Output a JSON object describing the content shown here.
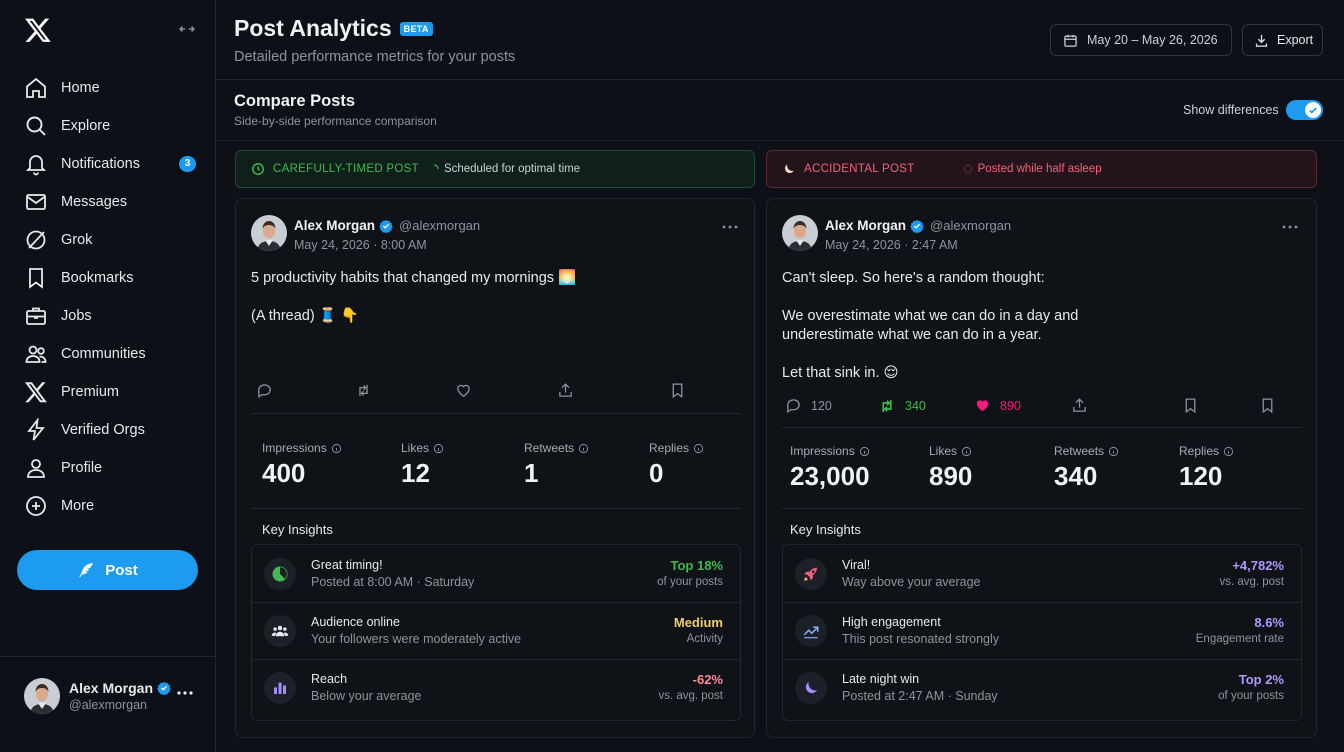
{
  "sidebar": {
    "items": [
      {
        "label": "Home",
        "icon": "home-icon"
      },
      {
        "label": "Explore",
        "icon": "search-icon"
      },
      {
        "label": "Notifications",
        "icon": "bell-icon",
        "badge": "3"
      },
      {
        "label": "Messages",
        "icon": "mail-icon"
      },
      {
        "label": "Grok",
        "icon": "grok-icon"
      },
      {
        "label": "Bookmarks",
        "icon": "bookmark-icon"
      },
      {
        "label": "Jobs",
        "icon": "briefcase-icon"
      },
      {
        "label": "Communities",
        "icon": "people-icon"
      },
      {
        "label": "Premium",
        "icon": "x-logo-icon"
      },
      {
        "label": "Verified Orgs",
        "icon": "lightning-icon"
      },
      {
        "label": "Profile",
        "icon": "user-icon"
      },
      {
        "label": "More",
        "icon": "more-circle-icon"
      }
    ],
    "post_button": "Post",
    "account": {
      "name": "Alex Morgan",
      "handle": "@alexmorgan"
    }
  },
  "header": {
    "title": "Post Analytics",
    "badge": "BETA",
    "subtitle": "Detailed performance metrics for your posts",
    "date_range": "May 20 – May 26, 2026",
    "export_label": "Export"
  },
  "compare": {
    "title": "Compare Posts",
    "subtitle": "Side-by-side performance comparison",
    "toggle_label": "Show differences",
    "toggle_on": true
  },
  "posts": [
    {
      "banner_tag": "CAREFULLY-TIMED POST",
      "banner_text": "Scheduled for optimal time",
      "accent": "#3fb950",
      "author": "Alex Morgan",
      "handle": "@alexmorgan",
      "date": "May 24, 2026 · 8:00 AM",
      "text": [
        "5 productivity habits that changed my mornings 🌅",
        "(A thread) 🧵 👇"
      ],
      "actions": {
        "replies": "",
        "retweets": "",
        "likes": ""
      },
      "stats": [
        {
          "label": "Impressions",
          "value": "400"
        },
        {
          "label": "Likes",
          "value": "12"
        },
        {
          "label": "Retweets",
          "value": "1"
        },
        {
          "label": "Replies",
          "value": "0"
        }
      ],
      "insights_title": "Key Insights",
      "insights": [
        {
          "icon": "clock-pie-icon",
          "title": "Great timing!",
          "sub": "Posted at 8:00 AM · Saturday",
          "value": "Top 18%",
          "value_sub": "of your posts",
          "color": "#3fb950"
        },
        {
          "icon": "people-icon",
          "title": "Audience online",
          "sub": "Your followers were moderately active",
          "value": "Medium",
          "value_sub": "Activity",
          "color": "#f2cc60"
        },
        {
          "icon": "bar-chart-icon",
          "title": "Reach",
          "sub": "Below your average",
          "value": "-62%",
          "value_sub": "vs. avg. post",
          "color": "#ff8a9a"
        }
      ]
    },
    {
      "banner_tag": "ACCIDENTAL POST",
      "banner_text": "Posted while half asleep",
      "accent": "#f4607a",
      "author": "Alex Morgan",
      "handle": "@alexmorgan",
      "date": "May 24, 2026 · 2:47 AM",
      "text": [
        "Can't sleep. So here's a random thought:",
        "We overestimate what we can do in a day and underestimate what we can do in a year.",
        "Let that sink in. 😌"
      ],
      "actions": {
        "replies": "120",
        "retweets": "340",
        "likes": "890"
      },
      "stats": [
        {
          "label": "Impressions",
          "value": "23,000"
        },
        {
          "label": "Likes",
          "value": "890"
        },
        {
          "label": "Retweets",
          "value": "340"
        },
        {
          "label": "Replies",
          "value": "120"
        }
      ],
      "insights_title": "Key Insights",
      "insights": [
        {
          "icon": "rocket-icon",
          "title": "Viral!",
          "sub": "Way above your average",
          "value": "+4,782%",
          "value_sub": "vs. avg. post",
          "color": "#b197fc"
        },
        {
          "icon": "trend-up-icon",
          "title": "High engagement",
          "sub": "This post resonated strongly",
          "value": "8.6%",
          "value_sub": "Engagement rate",
          "color": "#b197fc"
        },
        {
          "icon": "moon-icon",
          "title": "Late night win",
          "sub": "Posted at 2:47 AM · Sunday",
          "value": "Top 2%",
          "value_sub": "of your posts",
          "color": "#b197fc"
        }
      ]
    }
  ]
}
